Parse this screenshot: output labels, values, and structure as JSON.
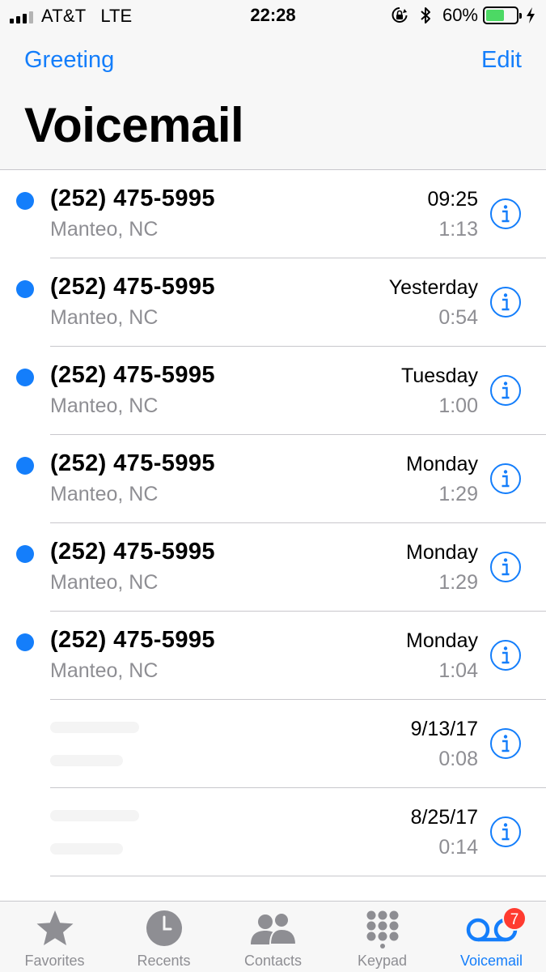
{
  "status_bar": {
    "carrier": "AT&T",
    "network": "LTE",
    "time": "22:28",
    "battery_percent": "60%",
    "battery_level": 0.6,
    "icons": [
      "signal-icon",
      "orientation-lock-icon",
      "bluetooth-icon",
      "battery-icon",
      "charging-icon"
    ]
  },
  "nav": {
    "left_label": "Greeting",
    "right_label": "Edit",
    "title": "Voicemail"
  },
  "voicemails": [
    {
      "caller": "(252) 475-5995",
      "location": "Manteo, NC",
      "when": "09:25",
      "duration": "1:13",
      "unread": true
    },
    {
      "caller": "(252) 475-5995",
      "location": "Manteo, NC",
      "when": "Yesterday",
      "duration": "0:54",
      "unread": true
    },
    {
      "caller": "(252) 475-5995",
      "location": "Manteo, NC",
      "when": "Tuesday",
      "duration": "1:00",
      "unread": true
    },
    {
      "caller": "(252) 475-5995",
      "location": "Manteo, NC",
      "when": "Monday",
      "duration": "1:29",
      "unread": true
    },
    {
      "caller": "(252) 475-5995",
      "location": "Manteo, NC",
      "when": "Monday",
      "duration": "1:29",
      "unread": true
    },
    {
      "caller": "(252) 475-5995",
      "location": "Manteo, NC",
      "when": "Monday",
      "duration": "1:04",
      "unread": true
    },
    {
      "caller": "",
      "location": "",
      "when": "9/13/17",
      "duration": "0:08",
      "unread": false,
      "redacted": true
    },
    {
      "caller": "",
      "location": "",
      "when": "8/25/17",
      "duration": "0:14",
      "unread": false,
      "redacted": true
    }
  ],
  "tab_bar": {
    "tabs": [
      {
        "id": "favorites",
        "label": "Favorites",
        "icon": "star-icon"
      },
      {
        "id": "recents",
        "label": "Recents",
        "icon": "clock-icon"
      },
      {
        "id": "contacts",
        "label": "Contacts",
        "icon": "contacts-icon"
      },
      {
        "id": "keypad",
        "label": "Keypad",
        "icon": "keypad-icon"
      },
      {
        "id": "voicemail",
        "label": "Voicemail",
        "icon": "voicemail-icon",
        "badge": "7",
        "active": true
      }
    ]
  },
  "colors": {
    "accent": "#147efb",
    "secondary_text": "#8e8e93",
    "badge": "#ff3b30",
    "battery": "#4cd964"
  }
}
